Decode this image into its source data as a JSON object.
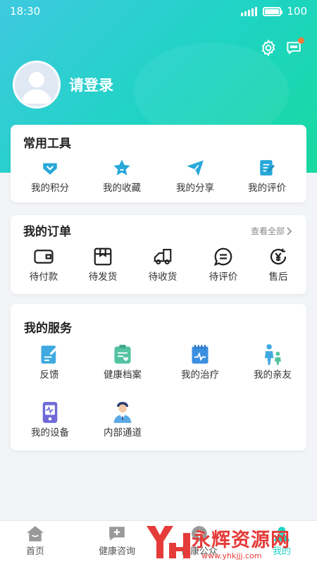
{
  "status_bar": {
    "time": "18:30",
    "battery": "100"
  },
  "header": {
    "login_text": "请登录",
    "accent_color": "#1ed4c3"
  },
  "tools": {
    "title": "常用工具",
    "items": [
      {
        "label": "我的积分",
        "icon": "diamond-icon"
      },
      {
        "label": "我的收藏",
        "icon": "star-icon"
      },
      {
        "label": "我的分享",
        "icon": "send-icon"
      },
      {
        "label": "我的评价",
        "icon": "edit-note-icon"
      }
    ]
  },
  "orders": {
    "title": "我的订单",
    "view_all": "查看全部",
    "items": [
      {
        "label": "待付款",
        "icon": "wallet-icon"
      },
      {
        "label": "待发货",
        "icon": "package-icon"
      },
      {
        "label": "待收货",
        "icon": "truck-icon"
      },
      {
        "label": "待评价",
        "icon": "comment-icon"
      },
      {
        "label": "售后",
        "icon": "yen-refund-icon"
      }
    ]
  },
  "services": {
    "title": "我的服务",
    "items": [
      {
        "label": "反馈",
        "icon": "feedback-icon"
      },
      {
        "label": "健康档案",
        "icon": "health-record-icon"
      },
      {
        "label": "我的治疗",
        "icon": "treatment-icon"
      },
      {
        "label": "我的亲友",
        "icon": "family-icon"
      },
      {
        "label": "我的设备",
        "icon": "device-icon"
      },
      {
        "label": "内部通道",
        "icon": "doctor-icon"
      }
    ]
  },
  "tabbar": {
    "items": [
      {
        "label": "首页",
        "icon": "home-icon"
      },
      {
        "label": "健康咨询",
        "icon": "consult-icon"
      },
      {
        "label": "健康公众",
        "icon": "public-icon"
      },
      {
        "label": "我的",
        "icon": "user-icon"
      }
    ]
  },
  "watermark": {
    "text": "永辉资源网",
    "url": "www.yhkjjj.com"
  }
}
